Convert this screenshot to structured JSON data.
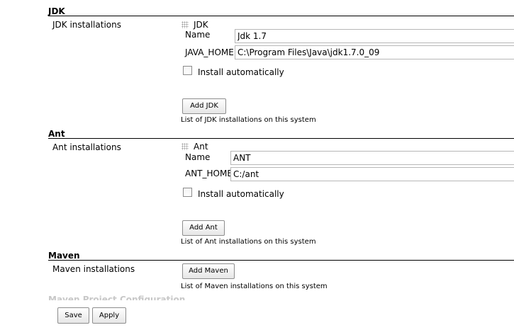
{
  "jdk": {
    "section_title": "JDK",
    "field_label": "JDK installations",
    "item_title": "JDK",
    "name_label": "Name",
    "name_value": "Jdk 1.7",
    "home_label": "JAVA_HOME",
    "home_value": "C:\\Program Files\\Java\\jdk1.7.0_09",
    "install_auto_label": "Install automatically",
    "add_button": "Add JDK",
    "description": "List of JDK installations on this system"
  },
  "ant": {
    "section_title": "Ant",
    "field_label": "Ant installations",
    "item_title": "Ant",
    "name_label": "Name",
    "name_value": "ANT",
    "home_label": "ANT_HOME",
    "home_value": "C:/ant",
    "install_auto_label": "Install automatically",
    "add_button": "Add Ant",
    "description": "List of Ant installations on this system"
  },
  "maven": {
    "section_title": "Maven",
    "field_label": "Maven installations",
    "add_button": "Add Maven",
    "description": "List of Maven installations on this system",
    "next_section_title": "Maven Project Configuration"
  },
  "footer": {
    "save_label": "Save",
    "apply_label": "Apply"
  }
}
